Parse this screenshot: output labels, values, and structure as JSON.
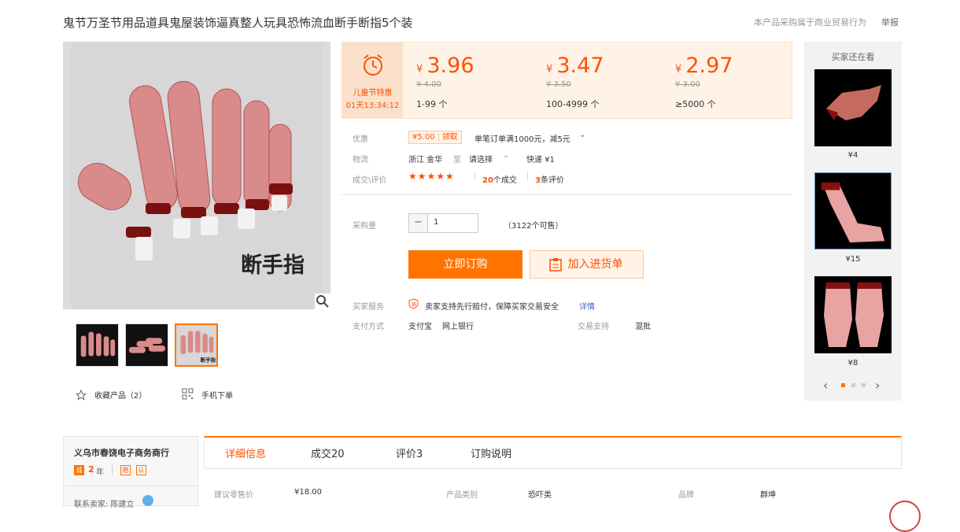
{
  "header": {
    "title": "鬼节万圣节用品道具鬼屋装饰逼真整人玩具恐怖流血断手断指5个装",
    "notice": "本产品采购属于商业贸易行为",
    "report": "举报"
  },
  "gallery": {
    "main_caption": "断手指",
    "zoom_icon": "magnifier-icon",
    "thumbs": [
      "thumb-1",
      "thumb-2",
      "thumb-3"
    ],
    "favorite_label": "收藏产品（2）",
    "mobile_label": "手机下单"
  },
  "price": {
    "promo_label": "儿童节特惠",
    "countdown": "01天13:34:12",
    "currency": "¥",
    "tiers": [
      {
        "price": "3.96",
        "old": "¥ 4.00",
        "range": "1-99 个"
      },
      {
        "price": "3.47",
        "old": "¥ 3.50",
        "range": "100-4999 个"
      },
      {
        "price": "2.97",
        "old": "¥ 3.00",
        "range": "≥5000 个"
      }
    ]
  },
  "details": {
    "coupon_label": "优惠",
    "coupon_amount": "¥5.00",
    "coupon_action": "领取",
    "coupon_desc": "单笔订单满1000元，减5元",
    "logistics_label": "物流",
    "logistics_from": "浙江 金华",
    "logistics_to_word": "至",
    "logistics_select": "请选择",
    "logistics_express": "快递 ¥1",
    "rating_label": "成交\\评价",
    "stars": "★★★★★",
    "deals_count": "20",
    "deals_text": "个成交",
    "reviews_count": "3",
    "reviews_text": "条评价"
  },
  "purchase": {
    "qty_label": "采购量",
    "qty_minus": "−",
    "qty_value": "1",
    "stock": "（3122个可售）",
    "buy_label": "立即订购",
    "cart_label": "加入进货单"
  },
  "service": {
    "label": "买家服务",
    "text": "卖家支持先行赔付，保障买家交易安全",
    "detail_link": "详情",
    "pay_label": "支付方式",
    "pay_alipay": "支付宝",
    "pay_bank": "网上银行",
    "trade_label": "交易支持",
    "trade_value": "混批"
  },
  "also_viewed": {
    "title": "买家还在看",
    "items": [
      {
        "price": "¥4"
      },
      {
        "price": "¥15"
      },
      {
        "price": "¥8"
      }
    ]
  },
  "seller": {
    "name": "义乌市春饶电子商务商行",
    "years": "2",
    "years_unit": "年",
    "contact": "联系卖家: 陈建立"
  },
  "tabs": [
    {
      "label": "详细信息"
    },
    {
      "label": "成交20"
    },
    {
      "label": "评价3"
    },
    {
      "label": "订购说明"
    }
  ],
  "attributes": [
    {
      "label": "建议零售价",
      "value": "¥18.00"
    },
    {
      "label": "产品类别",
      "value": "恐吓类"
    },
    {
      "label": "品牌",
      "value": "群坤"
    }
  ],
  "colors": {
    "accent": "#ff7300",
    "price": "#ff5000"
  }
}
